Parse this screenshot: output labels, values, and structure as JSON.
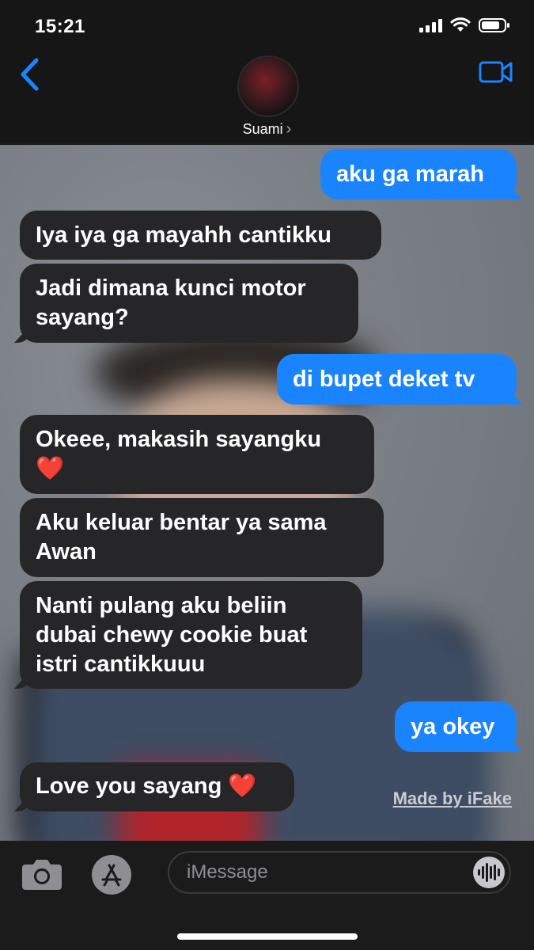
{
  "status_bar": {
    "time": "15:21"
  },
  "header": {
    "contact_name": "Suami",
    "contact_chevron": "›"
  },
  "messages": [
    {
      "direction": "outgoing",
      "text": "aku ga marah"
    },
    {
      "direction": "incoming",
      "text": "Iya iya ga mayahh cantikku"
    },
    {
      "direction": "incoming",
      "line1": "Jadi dimana kunci motor",
      "line2": "sayang?"
    },
    {
      "direction": "outgoing",
      "text": "di bupet deket tv"
    },
    {
      "direction": "incoming",
      "line1": "Okeee, makasih sayangku",
      "emoji": "❤️"
    },
    {
      "direction": "incoming",
      "line1": "Aku keluar bentar ya sama",
      "line2": "Awan"
    },
    {
      "direction": "incoming",
      "line1": "Nanti pulang aku beliin",
      "line2": "dubai chewy cookie buat",
      "line3": "istri cantikkuuu"
    },
    {
      "direction": "outgoing",
      "text": "ya okey"
    },
    {
      "direction": "incoming",
      "text": "Love you sayang",
      "emoji": "❤️"
    }
  ],
  "watermark": "Made by iFake",
  "composer": {
    "placeholder": "iMessage"
  },
  "colors": {
    "outgoing_bubble": "#1a84ff",
    "incoming_bubble": "#262628",
    "accent": "#1a84ff"
  },
  "icons": [
    "back-chevron-icon",
    "facetime-video-icon",
    "camera-icon",
    "app-store-icon",
    "audio-waveform-icon",
    "signal-icon",
    "wifi-icon",
    "battery-icon"
  ]
}
